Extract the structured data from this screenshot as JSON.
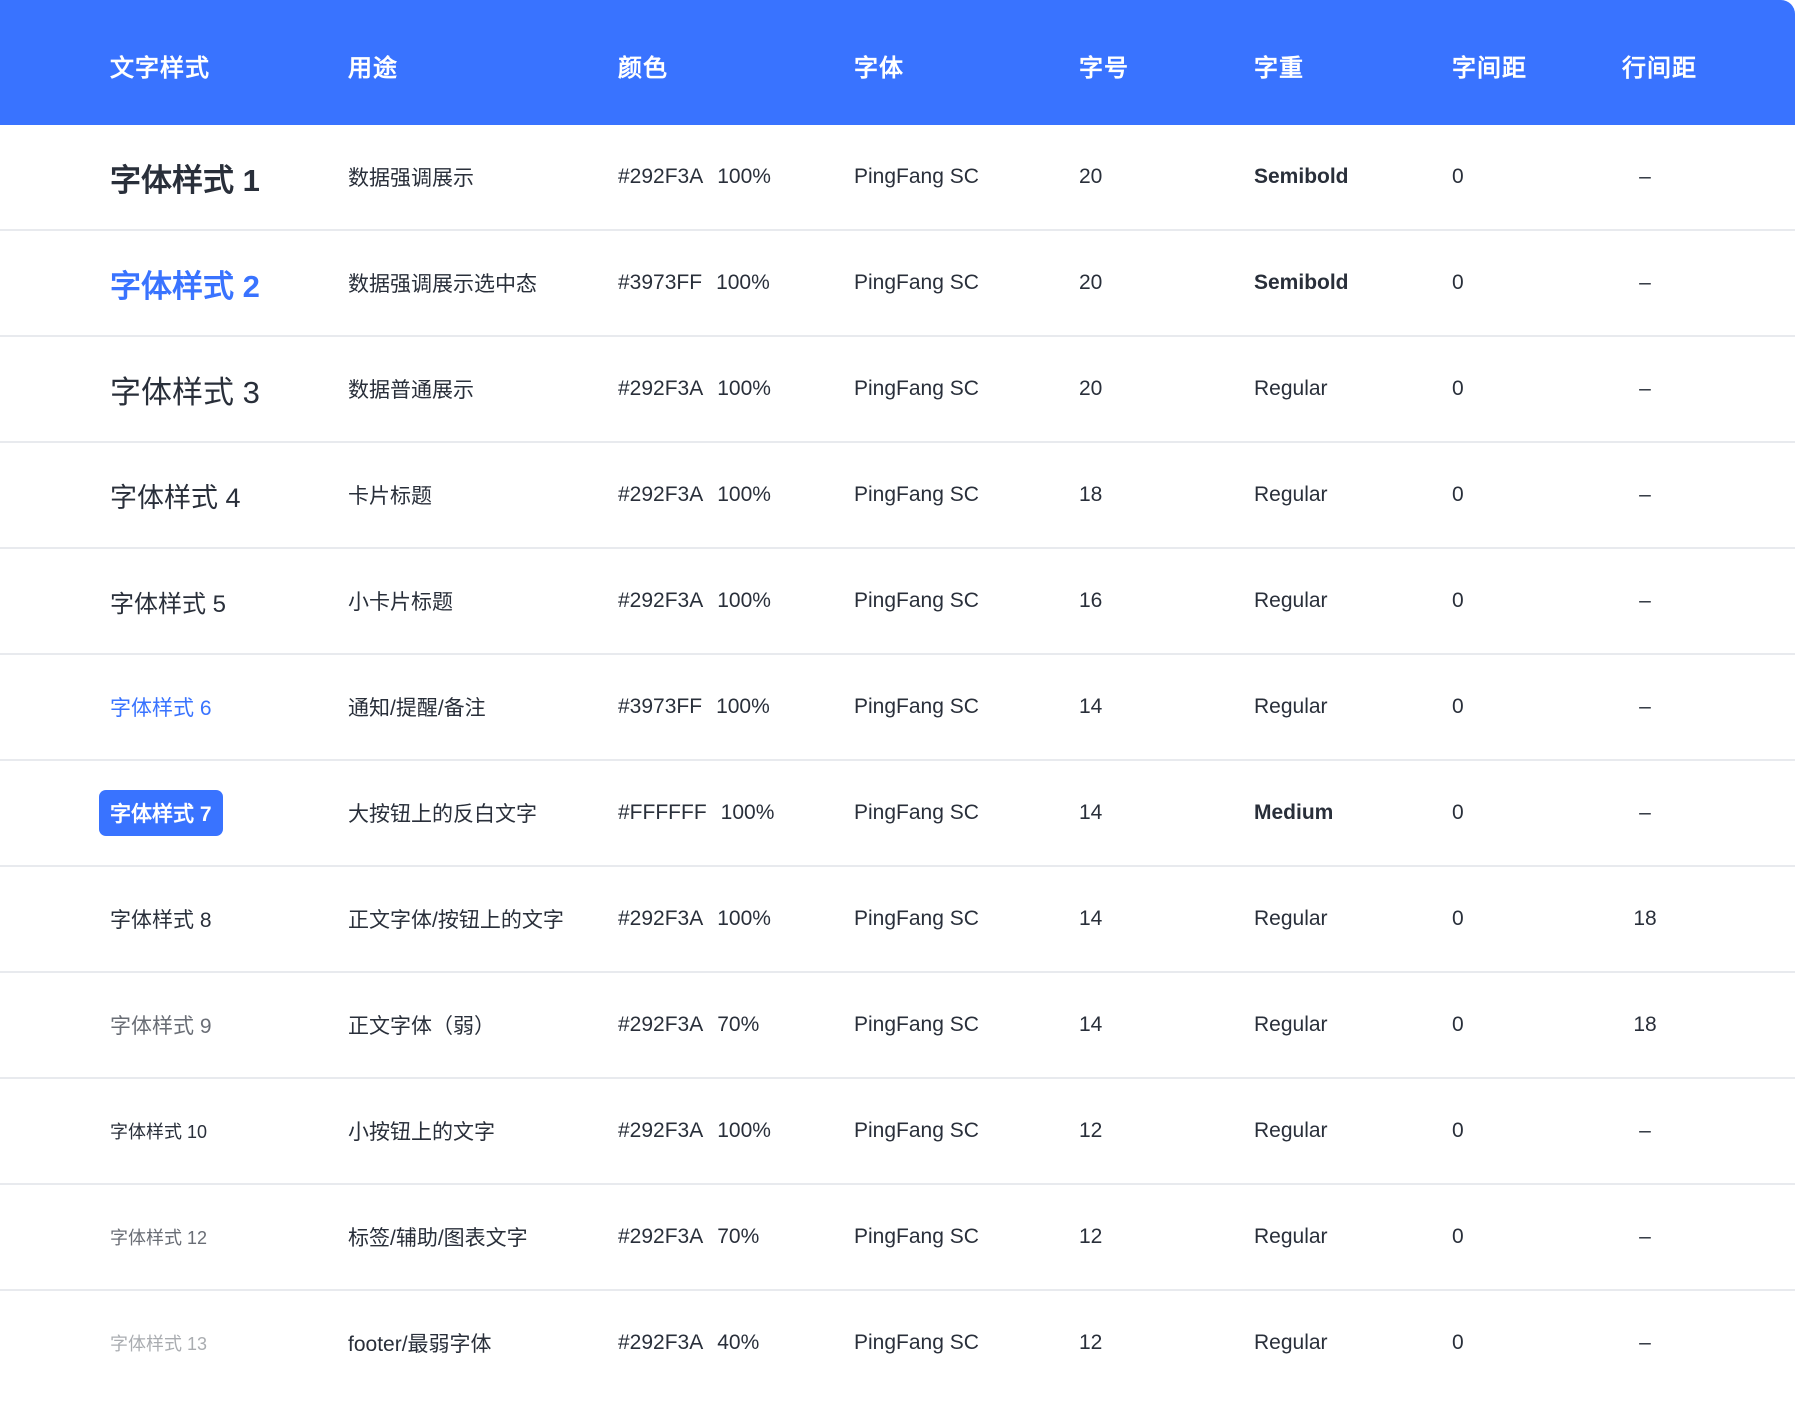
{
  "columns": [
    "文字样式",
    "用途",
    "颜色",
    "字体",
    "字号",
    "字重",
    "字间距",
    "行间距"
  ],
  "rows": [
    {
      "name": "字体样式 1",
      "usage": "数据强调展示",
      "hex": "#292F3A",
      "opacity": "100%",
      "font": "PingFang SC",
      "size": "20",
      "weight": "Semibold",
      "spacing": "0",
      "line_height": "–"
    },
    {
      "name": "字体样式 2",
      "usage": "数据强调展示选中态",
      "hex": "#3973FF",
      "opacity": "100%",
      "font": "PingFang SC",
      "size": "20",
      "weight": "Semibold",
      "spacing": "0",
      "line_height": "–"
    },
    {
      "name": "字体样式 3",
      "usage": "数据普通展示",
      "hex": "#292F3A",
      "opacity": "100%",
      "font": "PingFang SC",
      "size": "20",
      "weight": "Regular",
      "spacing": "0",
      "line_height": "–"
    },
    {
      "name": "字体样式 4",
      "usage": "卡片标题",
      "hex": "#292F3A",
      "opacity": "100%",
      "font": "PingFang SC",
      "size": "18",
      "weight": "Regular",
      "spacing": "0",
      "line_height": "–"
    },
    {
      "name": "字体样式 5",
      "usage": "小卡片标题",
      "hex": "#292F3A",
      "opacity": "100%",
      "font": "PingFang SC",
      "size": "16",
      "weight": "Regular",
      "spacing": "0",
      "line_height": "–"
    },
    {
      "name": "字体样式 6",
      "usage": "通知/提醒/备注",
      "hex": "#3973FF",
      "opacity": "100%",
      "font": "PingFang SC",
      "size": "14",
      "weight": "Regular",
      "spacing": "0",
      "line_height": "–"
    },
    {
      "name": "字体样式 7",
      "usage": "大按钮上的反白文字",
      "hex": "#FFFFFF",
      "opacity": "100%",
      "font": "PingFang SC",
      "size": "14",
      "weight": "Medium",
      "spacing": "0",
      "line_height": "–"
    },
    {
      "name": "字体样式 8",
      "usage": "正文字体/按钮上的文字",
      "hex": "#292F3A",
      "opacity": "100%",
      "font": "PingFang SC",
      "size": "14",
      "weight": "Regular",
      "spacing": "0",
      "line_height": "18"
    },
    {
      "name": "字体样式 9",
      "usage": "正文字体（弱）",
      "hex": "#292F3A",
      "opacity": "70%",
      "font": "PingFang SC",
      "size": "14",
      "weight": "Regular",
      "spacing": "0",
      "line_height": "18"
    },
    {
      "name": "字体样式 10",
      "usage": "小按钮上的文字",
      "hex": "#292F3A",
      "opacity": "100%",
      "font": "PingFang SC",
      "size": "12",
      "weight": "Regular",
      "spacing": "0",
      "line_height": "–"
    },
    {
      "name": "字体样式 12",
      "usage": "标签/辅助/图表文字",
      "hex": "#292F3A",
      "opacity": "70%",
      "font": "PingFang SC",
      "size": "12",
      "weight": "Regular",
      "spacing": "0",
      "line_height": "–"
    },
    {
      "name": "字体样式 13",
      "usage": "footer/最弱字体",
      "hex": "#292F3A",
      "opacity": "40%",
      "font": "PingFang SC",
      "size": "12",
      "weight": "Regular",
      "spacing": "0",
      "line_height": "–"
    }
  ],
  "colors": {
    "header_bg": "#3973FF",
    "text_primary": "#292F3A",
    "accent": "#3973FF",
    "divider": "#E8EAEE"
  }
}
